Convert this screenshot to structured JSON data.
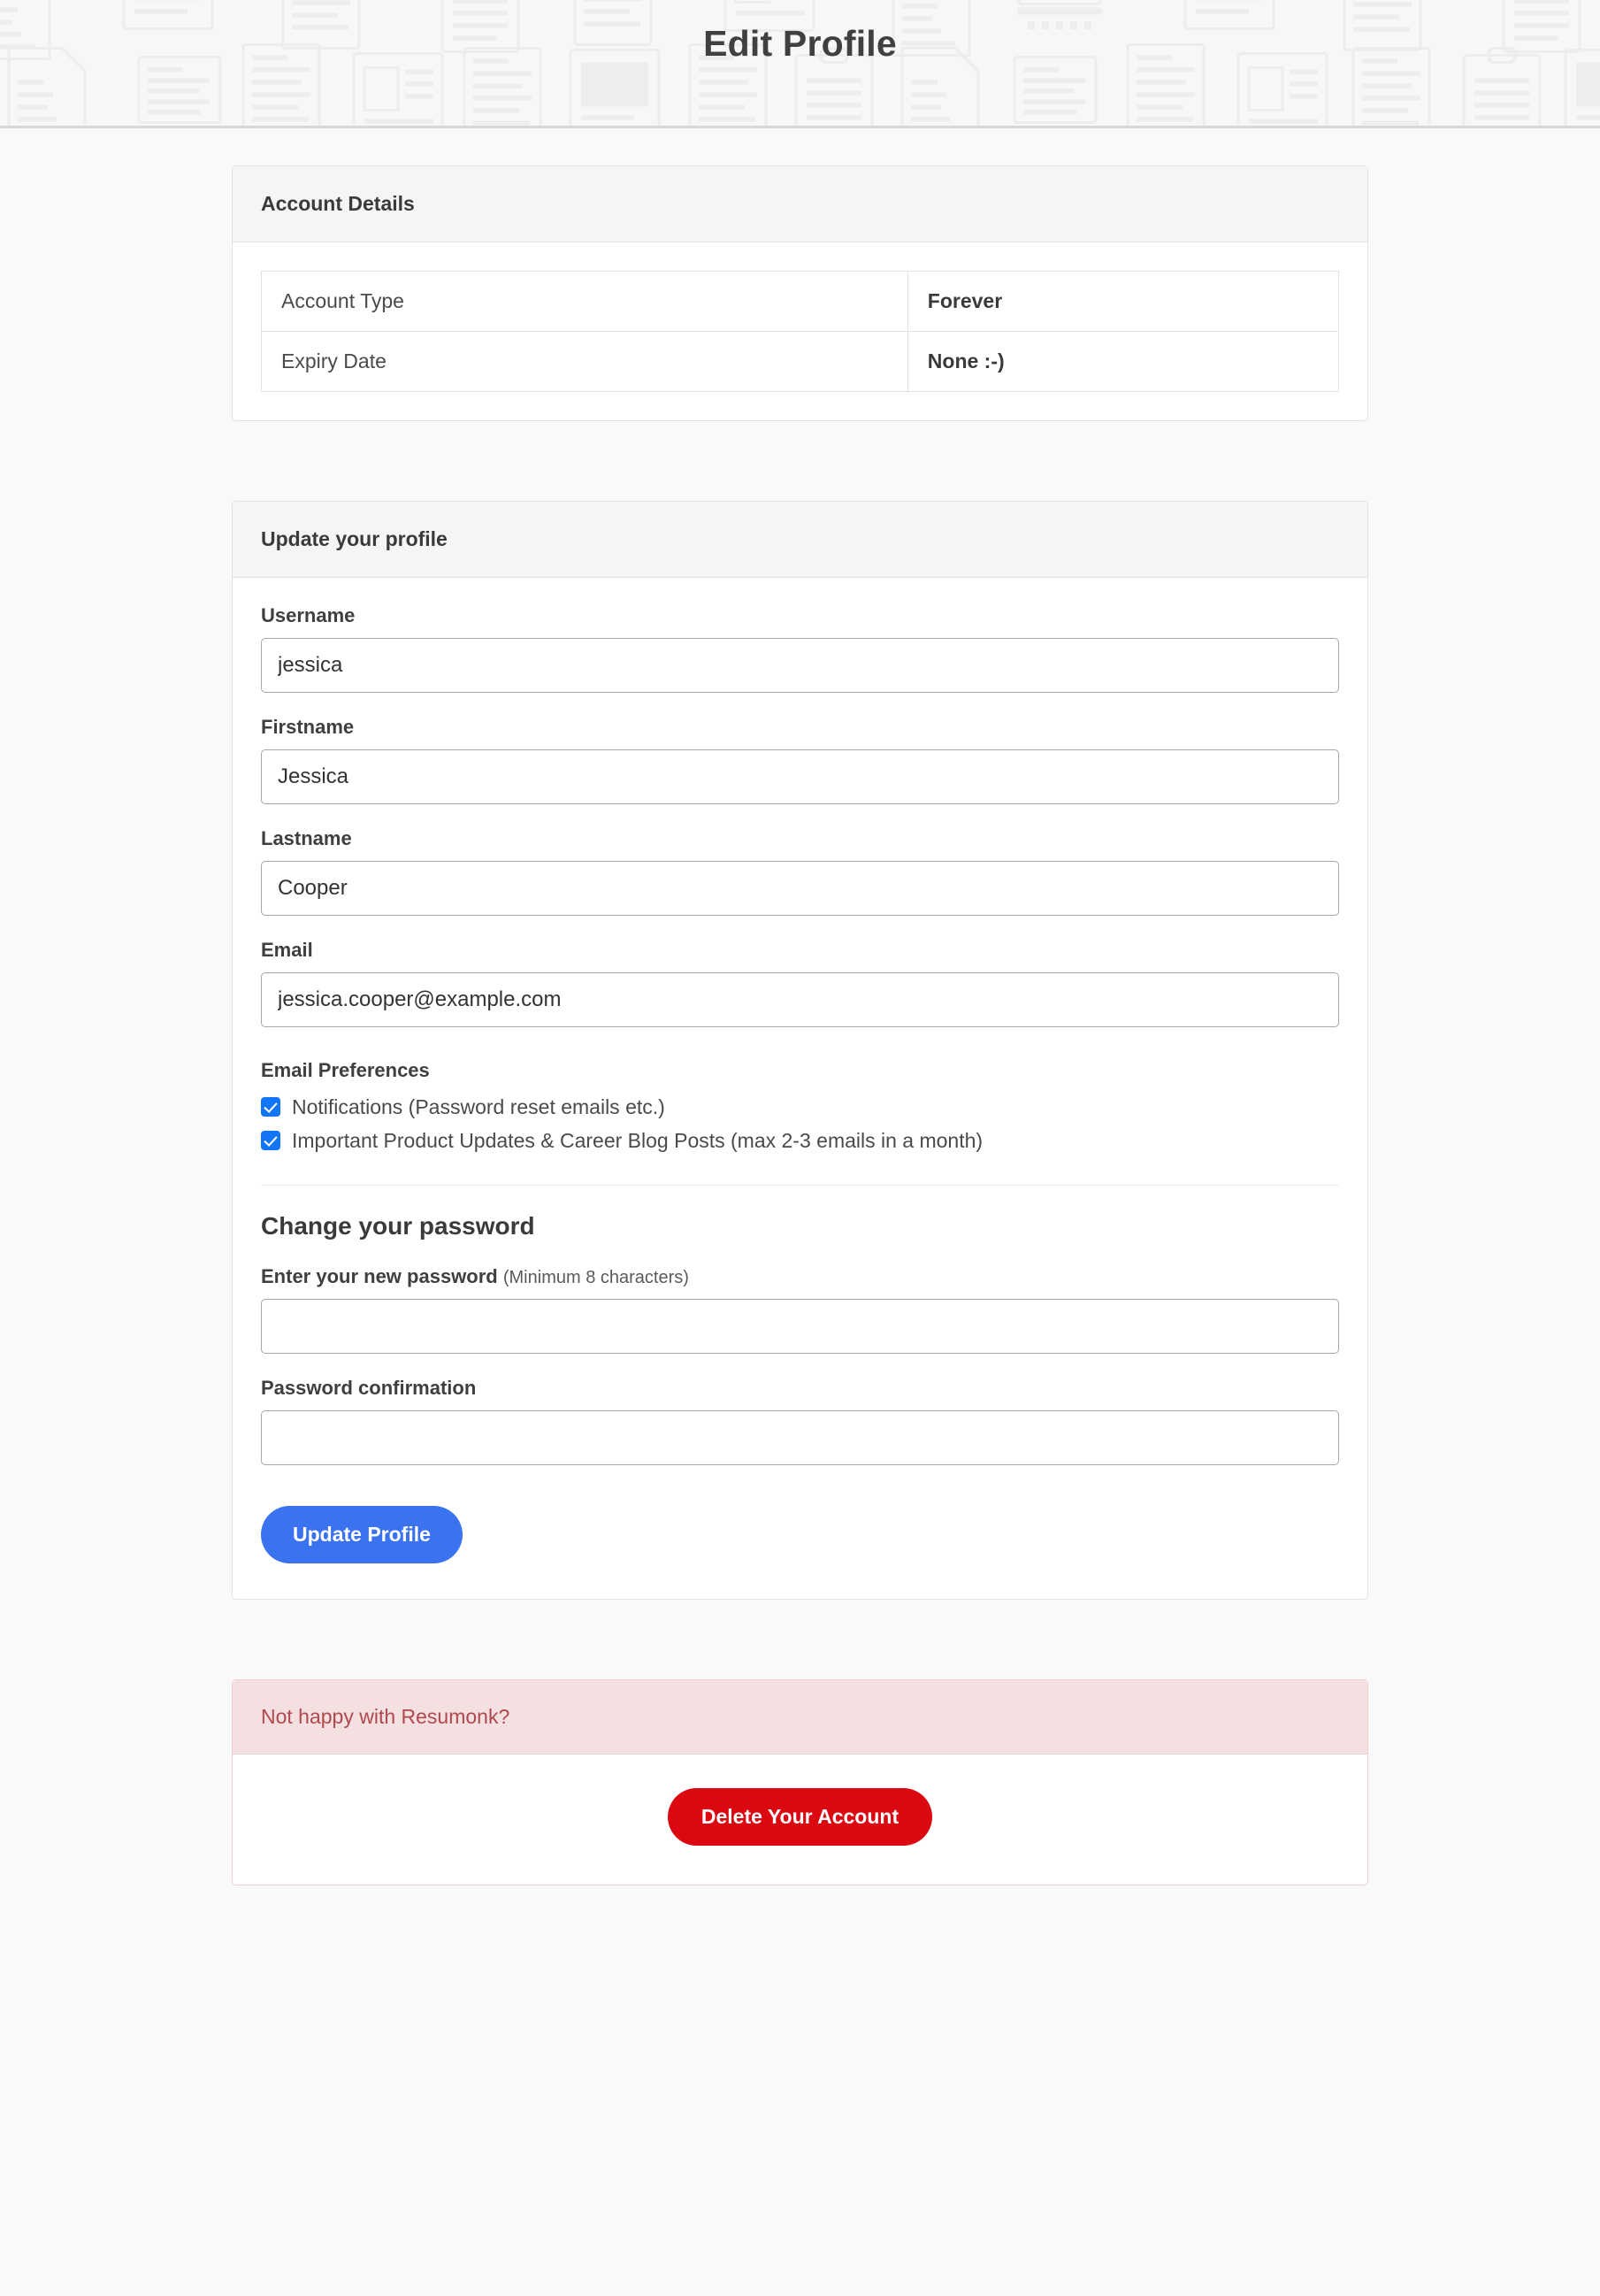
{
  "header": {
    "title": "Edit Profile",
    "pattern_icon": "document-pattern"
  },
  "account_details": {
    "card_title": "Account Details",
    "rows": [
      {
        "label": "Account Type",
        "value": "Forever"
      },
      {
        "label": "Expiry Date",
        "value": "None :-)"
      }
    ]
  },
  "profile_form": {
    "card_title": "Update your profile",
    "fields": [
      {
        "label": "Username",
        "value": "jessica",
        "placeholder": ""
      },
      {
        "label": "Firstname",
        "value": "Jessica",
        "placeholder": ""
      },
      {
        "label": "Lastname",
        "value": "Cooper",
        "placeholder": ""
      },
      {
        "label": "Email",
        "value": "jessica.cooper@example.com",
        "placeholder": ""
      }
    ],
    "email_preferences": {
      "label": "Email Preferences",
      "options": [
        {
          "label": "Notifications (Password reset emails etc.)",
          "checked": true
        },
        {
          "label": "Important Product Updates & Career Blog Posts (max 2-3 emails in a month)",
          "checked": true
        }
      ]
    },
    "password_section": {
      "title": "Change your password",
      "new_password_label": "Enter your new password",
      "new_password_hint": "(Minimum 8 characters)",
      "new_password_value": "",
      "confirm_label": "Password confirmation",
      "confirm_value": ""
    },
    "submit_label": "Update Profile"
  },
  "danger_zone": {
    "heading": "Not happy with Resumonk?",
    "delete_label": "Delete Your Account"
  },
  "colors": {
    "page_background": "#f9f9f9",
    "card_header_bg": "#f5f5f5",
    "primary_button": "#3b72f0",
    "danger_button": "#db0812",
    "danger_header_bg": "#f4dfe1",
    "danger_text": "#b0494d",
    "checkbox_accent": "#1175f5",
    "title_text": "#404040"
  }
}
